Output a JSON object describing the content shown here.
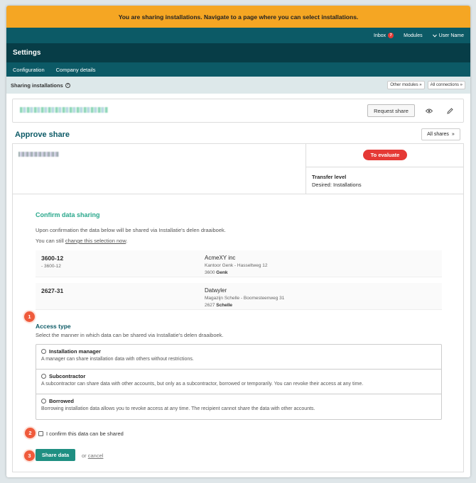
{
  "banner": {
    "text": "You are sharing installations. Navigate to a page where you can select installations."
  },
  "topbar": {
    "inbox_label": "Inbox",
    "inbox_count": "7",
    "modules_label": "Modules",
    "user_label": "User Name"
  },
  "header": {
    "title": "Settings"
  },
  "tabs": [
    {
      "label": "Configuration"
    },
    {
      "label": "Company details"
    }
  ],
  "subheader": {
    "title": "Sharing installations",
    "other_modules": "Other modules »",
    "all_connections": "All connections »"
  },
  "installation_card": {
    "request_share": "Request share"
  },
  "approve": {
    "title": "Approve share",
    "all_shares": "All shares",
    "status": "To evaluate",
    "transfer_title": "Transfer level",
    "transfer_value": "Desired: Installations"
  },
  "confirm": {
    "title": "Confirm data sharing",
    "line1": "Upon confirmation the data below will be shared via Installatie's delen draaiboek.",
    "line2_prefix": "You can still ",
    "line2_link": "change this selection now",
    "line2_suffix": "."
  },
  "shared_items": [
    {
      "code": "3600-12",
      "sub": "- 3600-12",
      "company": "AcmeXY inc",
      "address": "Kantoor Genk - Hasseltweg 12",
      "zip": "3600",
      "city": "Genk"
    },
    {
      "code": "2627-31",
      "sub": "",
      "company": "Datwyler",
      "address": "Magazijn Schelle - Boomesteenweg 31",
      "zip": "2627",
      "city": "Schelle"
    }
  ],
  "access": {
    "title": "Access type",
    "subtitle": "Select the manner in which data can be shared via Installatie's delen draaiboek.",
    "options": [
      {
        "label": "Installation manager",
        "desc": "A manager can share installation data with others without restrictions."
      },
      {
        "label": "Subcontractor",
        "desc": "A subcontractor can share data with other accounts, but only as a subcontractor, borrowed or temporarily. You can revoke their access at any time."
      },
      {
        "label": "Borrowed",
        "desc": "Borrowing installation data allows you to revoke access at any time. The recipient cannot share the data with other accounts."
      }
    ]
  },
  "confirm_checkbox": "I confirm this data can be shared",
  "actions": {
    "share": "Share data",
    "or": "or ",
    "cancel": "cancel"
  },
  "steps": [
    "1",
    "2",
    "3"
  ],
  "colors": {
    "banner": "#f5a623",
    "primary": "#0c5a66",
    "dark": "#073d47",
    "accent_green": "#2aa88c",
    "danger": "#e53935",
    "step": "#ef5a3b"
  }
}
